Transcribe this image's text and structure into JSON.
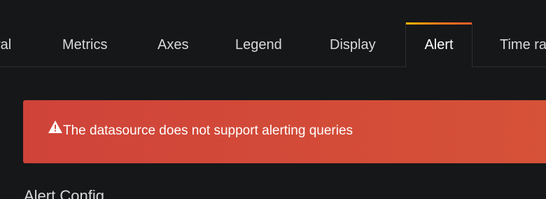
{
  "tabs": [
    {
      "label": "ral",
      "active": false
    },
    {
      "label": "Metrics",
      "active": false
    },
    {
      "label": "Axes",
      "active": false
    },
    {
      "label": "Legend",
      "active": false
    },
    {
      "label": "Display",
      "active": false
    },
    {
      "label": "Alert",
      "active": true
    },
    {
      "label": "Time ra",
      "active": false
    }
  ],
  "alert": {
    "icon": "warning-icon",
    "message": "The datasource does not support alerting queries",
    "background": "#d14a39"
  },
  "section": {
    "heading": "Alert Config"
  },
  "colors": {
    "background": "#161719",
    "active_tab_accent": "#ff7a1a"
  }
}
